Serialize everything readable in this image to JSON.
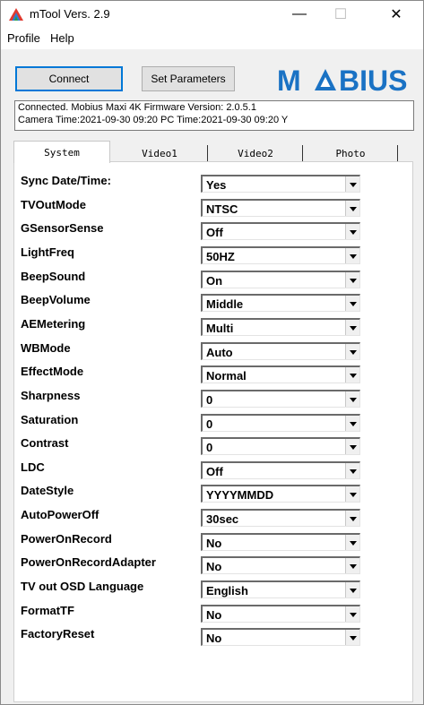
{
  "window": {
    "title": "mTool Vers. 2.9"
  },
  "window_controls": {
    "minimize": "—",
    "maximize": "☐",
    "close": "✕"
  },
  "menu": {
    "profile": "Profile",
    "help": "Help"
  },
  "toolbar": {
    "connect": "Connect",
    "set_parameters": "Set Parameters"
  },
  "logo": {
    "text": "MOBIUS",
    "color": "#1a72c4"
  },
  "status": {
    "line1": "Connected. Mobius Maxi 4K Firmware Version: 2.0.5.1",
    "line2": "Camera Time:2021-09-30 09:20  PC Time:2021-09-30 09:20  Y"
  },
  "tabs": [
    {
      "label": "System",
      "selected": true
    },
    {
      "label": "Video1",
      "selected": false
    },
    {
      "label": "Video2",
      "selected": false
    },
    {
      "label": "Photo",
      "selected": false
    }
  ],
  "settings": [
    {
      "label": "Sync Date/Time:",
      "value": "Yes"
    },
    {
      "label": "TVOutMode",
      "value": "NTSC"
    },
    {
      "label": "GSensorSense",
      "value": "Off"
    },
    {
      "label": "LightFreq",
      "value": "50HZ"
    },
    {
      "label": "BeepSound",
      "value": "On"
    },
    {
      "label": "BeepVolume",
      "value": "Middle"
    },
    {
      "label": "AEMetering",
      "value": "Multi"
    },
    {
      "label": "WBMode",
      "value": "Auto"
    },
    {
      "label": "EffectMode",
      "value": "Normal"
    },
    {
      "label": "Sharpness",
      "value": "0"
    },
    {
      "label": "Saturation",
      "value": "0"
    },
    {
      "label": "Contrast",
      "value": "0"
    },
    {
      "label": "LDC",
      "value": "Off"
    },
    {
      "label": "DateStyle",
      "value": "YYYYMMDD"
    },
    {
      "label": "AutoPowerOff",
      "value": "30sec"
    },
    {
      "label": "PowerOnRecord",
      "value": "No"
    },
    {
      "label": "PowerOnRecordAdapter",
      "value": "No"
    },
    {
      "label": "TV out OSD Language",
      "value": "English"
    },
    {
      "label": "FormatTF",
      "value": "No"
    },
    {
      "label": "FactoryReset",
      "value": "No"
    }
  ]
}
